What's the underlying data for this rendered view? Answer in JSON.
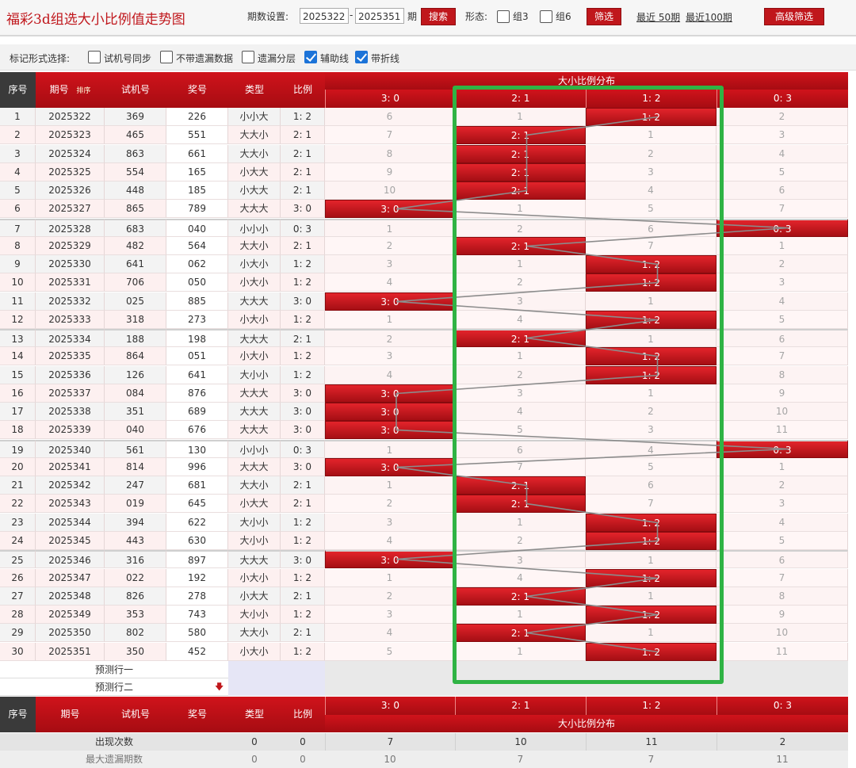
{
  "title": "福彩3d组选大小比例值走势图",
  "controls": {
    "period_label": "期数设置:",
    "from": "2025322",
    "dash": "-",
    "to": "2025351",
    "period_unit": "期",
    "search": "搜索",
    "shape_label": "形态:",
    "zu3": "组3",
    "zu6": "组6",
    "filter": "筛选",
    "recent50": "最近 50期",
    "recent100": "最近100期",
    "advanced": "高级筛选"
  },
  "options": {
    "label": "标记形式选择:",
    "items": [
      {
        "label": "试机号同步",
        "checked": false
      },
      {
        "label": "不带遗漏数据",
        "checked": false
      },
      {
        "label": "遗漏分层",
        "checked": false
      },
      {
        "label": "辅助线",
        "checked": true
      },
      {
        "label": "带折线",
        "checked": true
      }
    ]
  },
  "headers": {
    "idx": "序号",
    "period": "期号",
    "sort": "排序",
    "test": "试机号",
    "prize": "奖号",
    "type": "类型",
    "ratio": "比例",
    "dist": "大小比例分布",
    "cols": [
      "3: 0",
      "2: 1",
      "1: 2",
      "0: 3"
    ]
  },
  "rows": [
    {
      "i": "1",
      "p": "2025322",
      "t": "369",
      "z": "226",
      "ty": "小小大",
      "r": "1: 2",
      "d": [
        "6",
        "1",
        "1: 2",
        "2"
      ],
      "h": 2
    },
    {
      "i": "2",
      "p": "2025323",
      "t": "465",
      "z": "551",
      "ty": "大大小",
      "r": "2: 1",
      "d": [
        "7",
        "2: 1",
        "1",
        "3"
      ],
      "h": 1
    },
    {
      "i": "3",
      "p": "2025324",
      "t": "863",
      "z": "661",
      "ty": "大大小",
      "r": "2: 1",
      "d": [
        "8",
        "2: 1",
        "2",
        "4"
      ],
      "h": 1
    },
    {
      "i": "4",
      "p": "2025325",
      "t": "554",
      "z": "165",
      "ty": "小大大",
      "r": "2: 1",
      "d": [
        "9",
        "2: 1",
        "3",
        "5"
      ],
      "h": 1
    },
    {
      "i": "5",
      "p": "2025326",
      "t": "448",
      "z": "185",
      "ty": "小大大",
      "r": "2: 1",
      "d": [
        "10",
        "2: 1",
        "4",
        "6"
      ],
      "h": 1
    },
    {
      "i": "6",
      "p": "2025327",
      "t": "865",
      "z": "789",
      "ty": "大大大",
      "r": "3: 0",
      "d": [
        "3: 0",
        "1",
        "5",
        "7"
      ],
      "h": 0
    },
    {
      "i": "7",
      "p": "2025328",
      "t": "683",
      "z": "040",
      "ty": "小小小",
      "r": "0: 3",
      "d": [
        "1",
        "2",
        "6",
        "0: 3"
      ],
      "h": 3
    },
    {
      "i": "8",
      "p": "2025329",
      "t": "482",
      "z": "564",
      "ty": "大大小",
      "r": "2: 1",
      "d": [
        "2",
        "2: 1",
        "7",
        "1"
      ],
      "h": 1
    },
    {
      "i": "9",
      "p": "2025330",
      "t": "641",
      "z": "062",
      "ty": "小大小",
      "r": "1: 2",
      "d": [
        "3",
        "1",
        "1: 2",
        "2"
      ],
      "h": 2
    },
    {
      "i": "10",
      "p": "2025331",
      "t": "706",
      "z": "050",
      "ty": "小大小",
      "r": "1: 2",
      "d": [
        "4",
        "2",
        "1: 2",
        "3"
      ],
      "h": 2
    },
    {
      "i": "11",
      "p": "2025332",
      "t": "025",
      "z": "885",
      "ty": "大大大",
      "r": "3: 0",
      "d": [
        "3: 0",
        "3",
        "1",
        "4"
      ],
      "h": 0
    },
    {
      "i": "12",
      "p": "2025333",
      "t": "318",
      "z": "273",
      "ty": "小大小",
      "r": "1: 2",
      "d": [
        "1",
        "4",
        "1: 2",
        "5"
      ],
      "h": 2
    },
    {
      "i": "13",
      "p": "2025334",
      "t": "188",
      "z": "198",
      "ty": "大大大",
      "r": "2: 1",
      "d": [
        "2",
        "2: 1",
        "1",
        "6"
      ],
      "h": 1
    },
    {
      "i": "14",
      "p": "2025335",
      "t": "864",
      "z": "051",
      "ty": "小大小",
      "r": "1: 2",
      "d": [
        "3",
        "1",
        "1: 2",
        "7"
      ],
      "h": 2
    },
    {
      "i": "15",
      "p": "2025336",
      "t": "126",
      "z": "641",
      "ty": "大小小",
      "r": "1: 2",
      "d": [
        "4",
        "2",
        "1: 2",
        "8"
      ],
      "h": 2
    },
    {
      "i": "16",
      "p": "2025337",
      "t": "084",
      "z": "876",
      "ty": "大大大",
      "r": "3: 0",
      "d": [
        "3: 0",
        "3",
        "1",
        "9"
      ],
      "h": 0
    },
    {
      "i": "17",
      "p": "2025338",
      "t": "351",
      "z": "689",
      "ty": "大大大",
      "r": "3: 0",
      "d": [
        "3: 0",
        "4",
        "2",
        "10"
      ],
      "h": 0
    },
    {
      "i": "18",
      "p": "2025339",
      "t": "040",
      "z": "676",
      "ty": "大大大",
      "r": "3: 0",
      "d": [
        "3: 0",
        "5",
        "3",
        "11"
      ],
      "h": 0
    },
    {
      "i": "19",
      "p": "2025340",
      "t": "561",
      "z": "130",
      "ty": "小小小",
      "r": "0: 3",
      "d": [
        "1",
        "6",
        "4",
        "0: 3"
      ],
      "h": 3
    },
    {
      "i": "20",
      "p": "2025341",
      "t": "814",
      "z": "996",
      "ty": "大大大",
      "r": "3: 0",
      "d": [
        "3: 0",
        "7",
        "5",
        "1"
      ],
      "h": 0
    },
    {
      "i": "21",
      "p": "2025342",
      "t": "247",
      "z": "681",
      "ty": "大大小",
      "r": "2: 1",
      "d": [
        "1",
        "2: 1",
        "6",
        "2"
      ],
      "h": 1
    },
    {
      "i": "22",
      "p": "2025343",
      "t": "019",
      "z": "645",
      "ty": "小大大",
      "r": "2: 1",
      "d": [
        "2",
        "2: 1",
        "7",
        "3"
      ],
      "h": 1
    },
    {
      "i": "23",
      "p": "2025344",
      "t": "394",
      "z": "622",
      "ty": "大小小",
      "r": "1: 2",
      "d": [
        "3",
        "1",
        "1: 2",
        "4"
      ],
      "h": 2
    },
    {
      "i": "24",
      "p": "2025345",
      "t": "443",
      "z": "630",
      "ty": "大小小",
      "r": "1: 2",
      "d": [
        "4",
        "2",
        "1: 2",
        "5"
      ],
      "h": 2
    },
    {
      "i": "25",
      "p": "2025346",
      "t": "316",
      "z": "897",
      "ty": "大大大",
      "r": "3: 0",
      "d": [
        "3: 0",
        "3",
        "1",
        "6"
      ],
      "h": 0
    },
    {
      "i": "26",
      "p": "2025347",
      "t": "022",
      "z": "192",
      "ty": "小大小",
      "r": "1: 2",
      "d": [
        "1",
        "4",
        "1: 2",
        "7"
      ],
      "h": 2
    },
    {
      "i": "27",
      "p": "2025348",
      "t": "826",
      "z": "278",
      "ty": "小大大",
      "r": "2: 1",
      "d": [
        "2",
        "2: 1",
        "1",
        "8"
      ],
      "h": 1
    },
    {
      "i": "28",
      "p": "2025349",
      "t": "353",
      "z": "743",
      "ty": "大小小",
      "r": "1: 2",
      "d": [
        "3",
        "1",
        "1: 2",
        "9"
      ],
      "h": 2
    },
    {
      "i": "29",
      "p": "2025350",
      "t": "802",
      "z": "580",
      "ty": "大大小",
      "r": "2: 1",
      "d": [
        "4",
        "2: 1",
        "1",
        "10"
      ],
      "h": 1
    },
    {
      "i": "30",
      "p": "2025351",
      "t": "350",
      "z": "452",
      "ty": "小大小",
      "r": "1: 2",
      "d": [
        "5",
        "1",
        "1: 2",
        "11"
      ],
      "h": 2
    }
  ],
  "predict": {
    "row1": "预测行一",
    "row2": "预测行二"
  },
  "footer": {
    "count_label": "出现次数",
    "count_type": "0",
    "count_ratio": "0",
    "counts": [
      "7",
      "10",
      "11",
      "2"
    ],
    "max_label": "最大遗漏期数",
    "max_type": "0",
    "max_ratio": "0",
    "max_vals": [
      "10",
      "7",
      "7",
      "11"
    ]
  },
  "colors": {
    "accent": "#c0171c",
    "highlight_box": "#2fb344"
  }
}
